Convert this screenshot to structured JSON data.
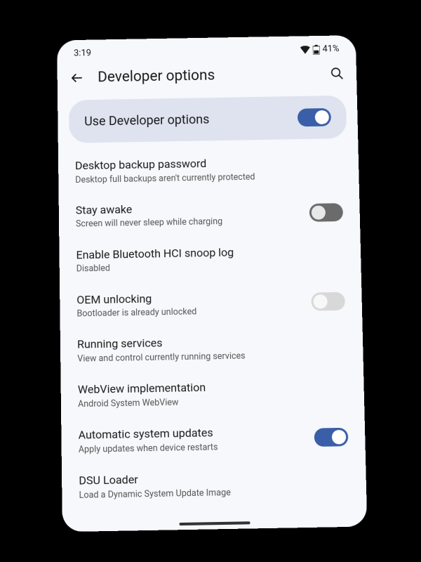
{
  "status": {
    "time": "3:19",
    "battery": "41%"
  },
  "header": {
    "title": "Developer options"
  },
  "master": {
    "label": "Use Developer options",
    "enabled": true
  },
  "settings": [
    {
      "key": "desktop-backup",
      "title": "Desktop backup password",
      "subtitle": "Desktop full backups aren't currently protected",
      "toggle": null
    },
    {
      "key": "stay-awake",
      "title": "Stay awake",
      "subtitle": "Screen will never sleep while charging",
      "toggle": "off-dark"
    },
    {
      "key": "bt-hci-snoop",
      "title": "Enable Bluetooth HCI snoop log",
      "subtitle": "Disabled",
      "toggle": null
    },
    {
      "key": "oem-unlocking",
      "title": "OEM unlocking",
      "subtitle": "Bootloader is already unlocked",
      "toggle": "off-light"
    },
    {
      "key": "running-services",
      "title": "Running services",
      "subtitle": "View and control currently running services",
      "toggle": null
    },
    {
      "key": "webview-impl",
      "title": "WebView implementation",
      "subtitle": "Android System WebView",
      "toggle": null
    },
    {
      "key": "auto-updates",
      "title": "Automatic system updates",
      "subtitle": "Apply updates when device restarts",
      "toggle": "on"
    },
    {
      "key": "dsu-loader",
      "title": "DSU Loader",
      "subtitle": "Load a Dynamic System Update Image",
      "toggle": null
    }
  ]
}
